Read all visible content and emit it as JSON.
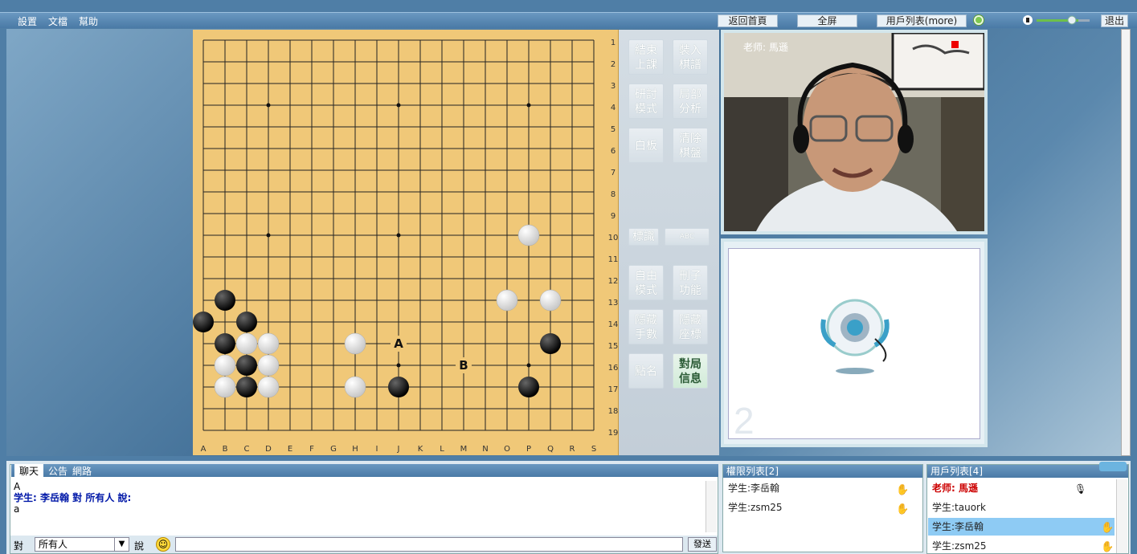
{
  "menu": {
    "settings": "設置",
    "file": "文檔",
    "help": "幫助"
  },
  "toolbar": {
    "home": "返回首頁",
    "fullscreen": "全屏",
    "userlist": "用戶列表(more)",
    "exit": "退出"
  },
  "board": {
    "columns": [
      "A",
      "B",
      "C",
      "D",
      "E",
      "F",
      "G",
      "H",
      "I",
      "J",
      "K",
      "L",
      "M",
      "N",
      "O",
      "P",
      "Q",
      "R",
      "S"
    ],
    "rows": [
      "1",
      "2",
      "3",
      "4",
      "5",
      "6",
      "7",
      "8",
      "9",
      "10",
      "11",
      "12",
      "13",
      "14",
      "15",
      "16",
      "17",
      "18",
      "19"
    ],
    "black": [
      [
        "B",
        13
      ],
      [
        "A",
        14
      ],
      [
        "C",
        14
      ],
      [
        "B",
        15
      ],
      [
        "C",
        16
      ],
      [
        "C",
        17
      ],
      [
        "J",
        17
      ],
      [
        "Q",
        15
      ],
      [
        "P",
        17
      ]
    ],
    "white": [
      [
        "P",
        10
      ],
      [
        "O",
        13
      ],
      [
        "Q",
        13
      ],
      [
        "C",
        15
      ],
      [
        "D",
        15
      ],
      [
        "H",
        15
      ],
      [
        "B",
        16
      ],
      [
        "D",
        16
      ],
      [
        "B",
        17
      ],
      [
        "D",
        17
      ],
      [
        "H",
        17
      ]
    ],
    "marks": [
      {
        "label": "A",
        "col": "J",
        "row": 15
      },
      {
        "label": "B",
        "col": "M",
        "row": 16
      }
    ]
  },
  "functions": {
    "end_class": "結束\n上課",
    "load_record": "裝入\n棋譜",
    "study": "研討\n模式",
    "local": "局部\n分析",
    "whiteboard": "白板",
    "clear": "清除\n棋盤",
    "mark": "標識",
    "abc": "ABC",
    "free": "自由\n模式",
    "delete": "刪子\n功能",
    "hide_moves": "隱藏\n手數",
    "hide_coords": "隱藏\n座標",
    "rollcall": "點名",
    "game_info": "對局\n信息"
  },
  "video": {
    "teacher_label": "老师: 馬遜",
    "slot2": "2"
  },
  "chat": {
    "tabs": [
      "聊天",
      "公告",
      "網路"
    ],
    "lines": [
      {
        "text": "A"
      },
      {
        "text": "学生: 李岳翰 對 所有人 說:"
      },
      {
        "text": "a"
      }
    ],
    "to_label": "對",
    "target": "所有人",
    "say_label": "說",
    "send": "發送"
  },
  "perm": {
    "title": "權限列表[2]",
    "users": [
      "学生:李岳翰",
      "学生:zsm25"
    ]
  },
  "users": {
    "title": "用戶列表[4]",
    "list": [
      "老师: 馬遜",
      "学生:tauork",
      "学生:李岳翰",
      "学生:zsm25"
    ]
  }
}
